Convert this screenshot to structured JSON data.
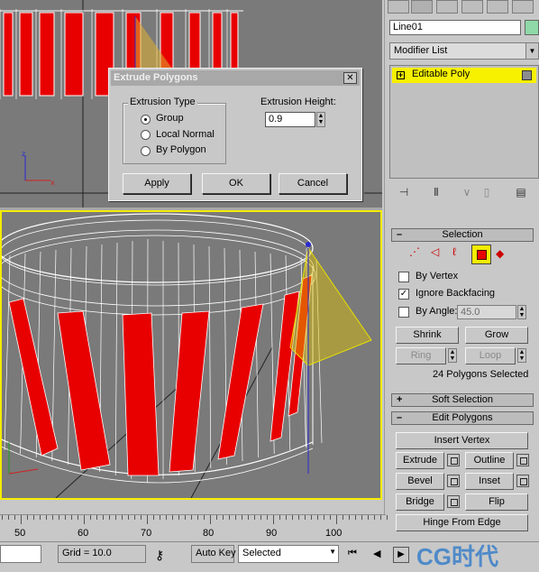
{
  "dialog": {
    "title": "Extrude Polygons",
    "extrusion_type_label": "Extrusion Type",
    "options": [
      "Group",
      "Local Normal",
      "By Polygon"
    ],
    "selected_option": "Group",
    "height_label": "Extrusion Height:",
    "height_value": "0.9",
    "buttons": {
      "apply": "Apply",
      "ok": "OK",
      "cancel": "Cancel"
    },
    "close_glyph": "✕"
  },
  "panel": {
    "object_name": "Line01",
    "modifier_list": "Modifier List",
    "stack_item": "Editable Poly",
    "stack_item_expander": "+"
  },
  "selection": {
    "header": "Selection",
    "by_vertex": "By Vertex",
    "ignore_backfacing": "Ignore Backfacing",
    "ignore_backfacing_checked": true,
    "by_angle": "By Angle:",
    "angle_value": "45.0",
    "shrink": "Shrink",
    "grow": "Grow",
    "ring": "Ring",
    "loop": "Loop",
    "status": "24 Polygons Selected"
  },
  "soft_selection": {
    "header": "Soft Selection",
    "sign": "+"
  },
  "edit_polygons": {
    "header": "Edit Polygons",
    "sign": "–",
    "insert_vertex": "Insert Vertex",
    "extrude": "Extrude",
    "outline": "Outline",
    "bevel": "Bevel",
    "inset": "Inset",
    "bridge": "Bridge",
    "flip": "Flip",
    "hinge": "Hinge From Edge"
  },
  "timeline": {
    "labels": [
      "50",
      "60",
      "70",
      "80",
      "90",
      "100"
    ]
  },
  "statusbar": {
    "grid": "Grid = 10.0",
    "auto_key": "Auto Key",
    "selected": "Selected",
    "watermark": "CG时代"
  },
  "colors": {
    "accent_yellow": "#f4ec00",
    "selected_red": "#e80000",
    "viewport_gray": "#7a7a7a"
  }
}
